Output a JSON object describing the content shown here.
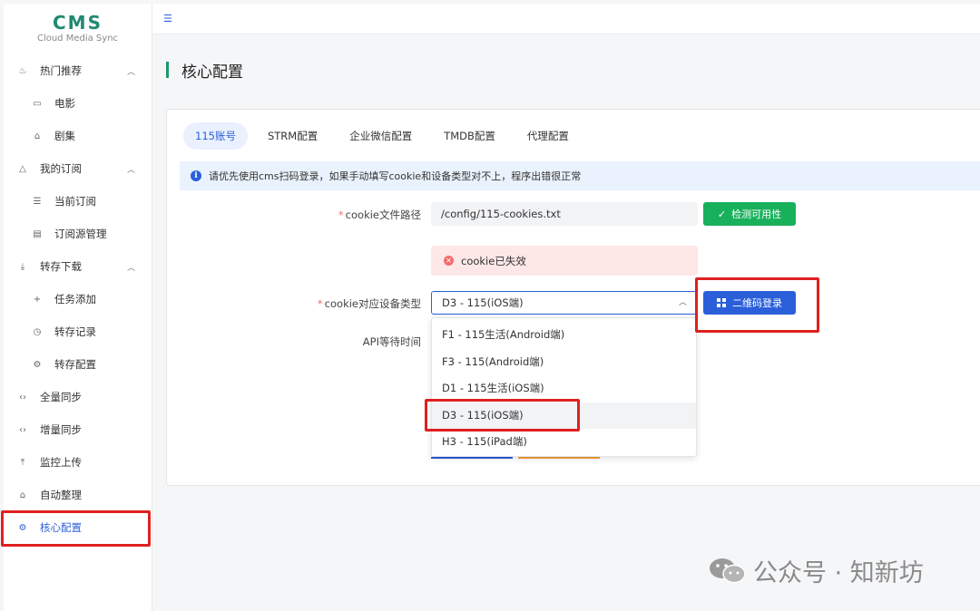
{
  "app": {
    "logo_title": "CMS",
    "logo_subtitle": "Cloud Media Sync"
  },
  "sidebar": {
    "items": [
      {
        "label": "热门推荐",
        "icon": "fire-icon",
        "glyph": "♨",
        "level": 1,
        "arrow": "︿"
      },
      {
        "label": "电影",
        "icon": "video-icon",
        "glyph": "▭",
        "level": 2
      },
      {
        "label": "剧集",
        "icon": "tv-icon",
        "glyph": "⌂",
        "level": 2
      },
      {
        "label": "我的订阅",
        "icon": "bell-icon",
        "glyph": "△",
        "level": 1,
        "arrow": "︿"
      },
      {
        "label": "当前订阅",
        "icon": "list-icon",
        "glyph": "☰",
        "level": 2
      },
      {
        "label": "订阅源管理",
        "icon": "document-icon",
        "glyph": "▤",
        "level": 2
      },
      {
        "label": "转存下载",
        "icon": "download-icon",
        "glyph": "⤓",
        "level": 1,
        "arrow": "︿"
      },
      {
        "label": "任务添加",
        "icon": "plus-icon",
        "glyph": "+",
        "level": 2
      },
      {
        "label": "转存记录",
        "icon": "history-icon",
        "glyph": "◷",
        "level": 2
      },
      {
        "label": "转存配置",
        "icon": "gear-icon",
        "glyph": "⚙",
        "level": 2
      },
      {
        "label": "全量同步",
        "icon": "sync-icon",
        "glyph": "‹›",
        "level": 1
      },
      {
        "label": "增量同步",
        "icon": "sync-icon",
        "glyph": "‹›",
        "level": 1
      },
      {
        "label": "监控上传",
        "icon": "upload-icon",
        "glyph": "⤒",
        "level": 1
      },
      {
        "label": "自动整理",
        "icon": "robot-icon",
        "glyph": "⌂",
        "level": 1
      },
      {
        "label": "核心配置",
        "icon": "settings-icon",
        "glyph": "⚙",
        "level": 1,
        "active": true
      }
    ]
  },
  "main": {
    "page_title": "核心配置",
    "tabs": [
      "115账号",
      "STRM配置",
      "企业微信配置",
      "TMDB配置",
      "代理配置"
    ],
    "active_tab": "115账号",
    "alert_text": "请优先使用cms扫码登录，如果手动填写cookie和设备类型对不上，程序出错很正常",
    "form": {
      "cookie_path_label": "cookie文件路径",
      "cookie_path_value": "/config/115-cookies.txt",
      "check_button": "检测可用性",
      "cookie_status": "cookie已失效",
      "device_type_label": "cookie对应设备类型",
      "device_type_value": "D3 - 115(iOS端)",
      "qr_login_button": "二维码登录",
      "api_wait_label": "API等待时间",
      "required_mark": "*"
    },
    "dropdown_options": [
      "F1 - 115生活(Android端)",
      "F3 - 115(Android端)",
      "D1 - 115生活(iOS端)",
      "D3 - 115(iOS端)",
      "H3 - 115(iPad端)"
    ],
    "selected_option_index": 3
  },
  "watermark": {
    "text": "公众号 · 知新坊"
  },
  "colors": {
    "accent": "#2b5fd9",
    "success": "#19b05b",
    "danger": "#f56c6c",
    "highlight": "#e02020",
    "brand": "#1f8a70"
  }
}
